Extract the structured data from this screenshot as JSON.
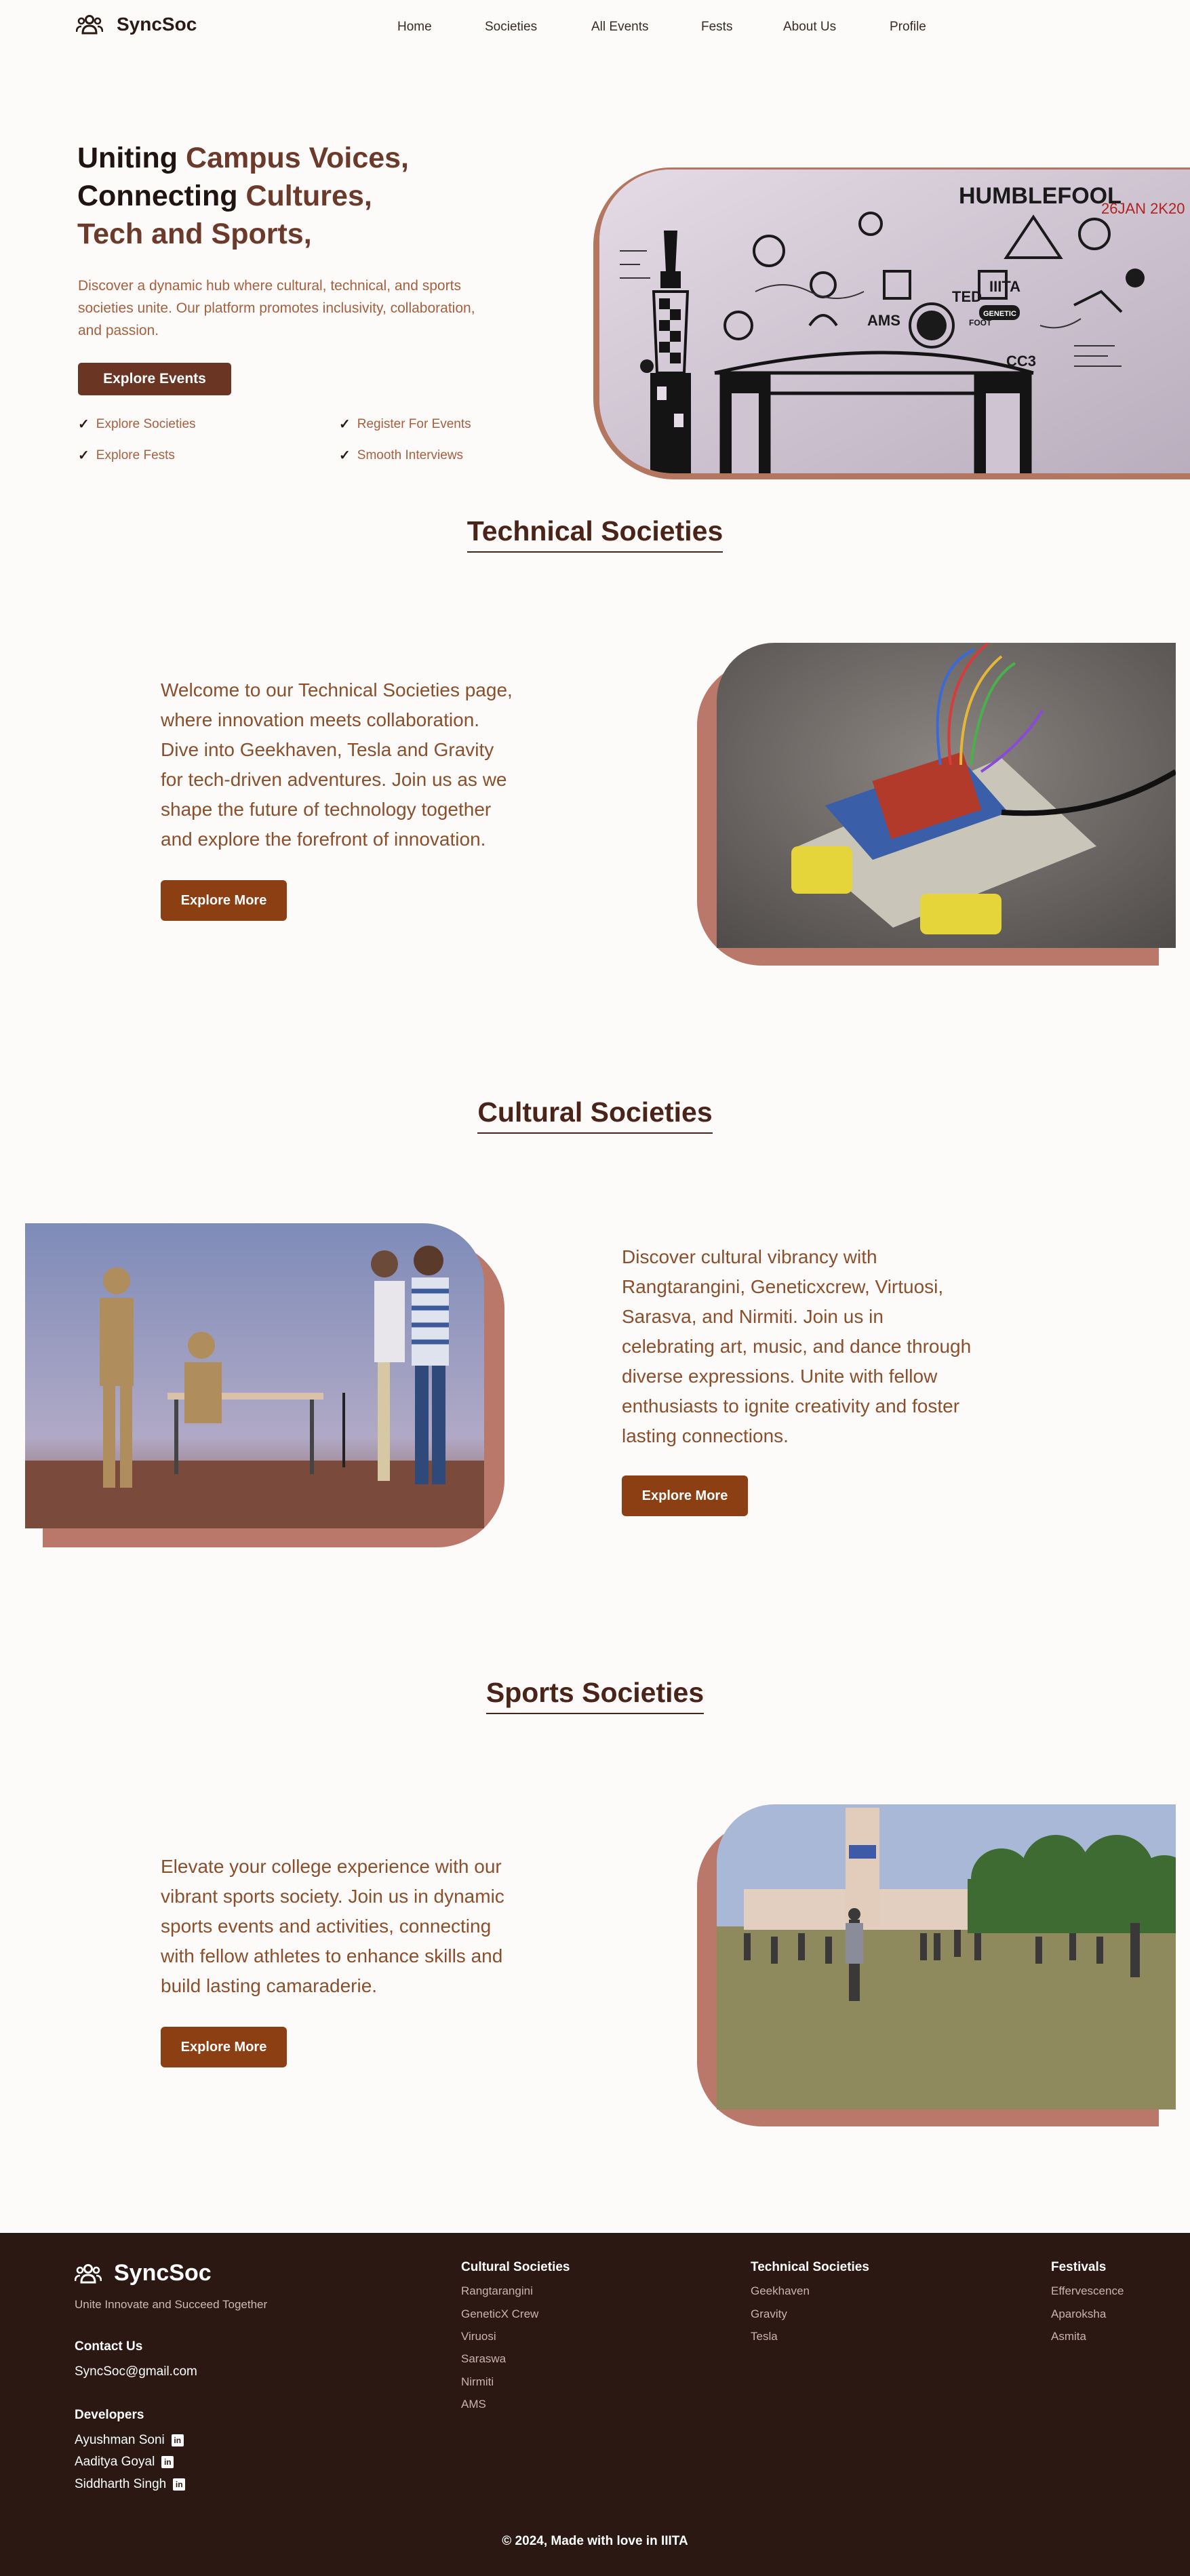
{
  "nav": {
    "brand": "SyncSoc",
    "brand_icon": "users-group-icon",
    "links": [
      "Home",
      "Societies",
      "All Events",
      "Fests",
      "About Us",
      "Profile"
    ]
  },
  "hero": {
    "title_parts": [
      {
        "text": "Uniting ",
        "accent": false
      },
      {
        "text": "Campus Voices,",
        "accent": true
      },
      {
        "text": "Connecting ",
        "accent": false
      },
      {
        "text": "Cultures,",
        "accent": true
      },
      {
        "text": "Tech and Sports,",
        "accent": true
      }
    ],
    "description": "Discover a dynamic hub where cultural, technical, and sports societies unite. Our platform promotes inclusivity, collaboration, and passion.",
    "cta": "Explore Events",
    "features": [
      "Explore Societies",
      "Register For Events",
      "Explore Fests",
      "Smooth Interviews"
    ],
    "image_texts": {
      "headline": "HUMBLEFOOL",
      "date": "26JAN 2K20",
      "words": [
        "AMS",
        "TED",
        "IIITA",
        "GENETIC",
        "CC3",
        "FOOT"
      ]
    }
  },
  "sections": [
    {
      "title": "Technical Societies",
      "text": "Welcome to our Technical Societies page, where innovation meets collaboration. Dive into Geekhaven, Tesla and Gravity for tech-driven adventures. Join us as we shape the future of technology together and explore the forefront of innovation.",
      "button": "Explore More"
    },
    {
      "title": "Cultural Societies",
      "text": "Discover cultural vibrancy with Rangtarangini, Geneticxcrew, Virtuosi, Sarasva, and Nirmiti. Join us in celebrating art, music, and dance through diverse expressions. Unite with fellow enthusiasts to ignite creativity and foster lasting connections.",
      "button": "Explore More"
    },
    {
      "title": "Sports Societies",
      "text": "Elevate your college experience with our vibrant sports society. Join us in dynamic sports events and activities, connecting with fellow athletes to enhance skills and build lasting camaraderie.",
      "button": "Explore More"
    }
  ],
  "footer": {
    "brand": "SyncSoc",
    "tagline": "Unite Innovate and Succeed Together",
    "contact_heading": "Contact Us",
    "email": "SyncSoc@gmail.com",
    "developers_heading": "Developers",
    "developers": [
      "Ayushman Soni",
      "Aaditya Goyal",
      "Siddharth Singh"
    ],
    "columns": [
      {
        "heading": "Cultural Societies",
        "items": [
          "Rangtarangini",
          "GeneticX Crew",
          "Viruosi",
          "Saraswa",
          "Nirmiti",
          "AMS"
        ]
      },
      {
        "heading": "Technical Societies",
        "items": [
          "Geekhaven",
          "Gravity",
          "Tesla"
        ]
      },
      {
        "heading": "Festivals",
        "items": [
          "Effervescence",
          "Aparoksha",
          "Asmita"
        ]
      }
    ],
    "copyright": "© 2024, Made with love in IIITA"
  }
}
